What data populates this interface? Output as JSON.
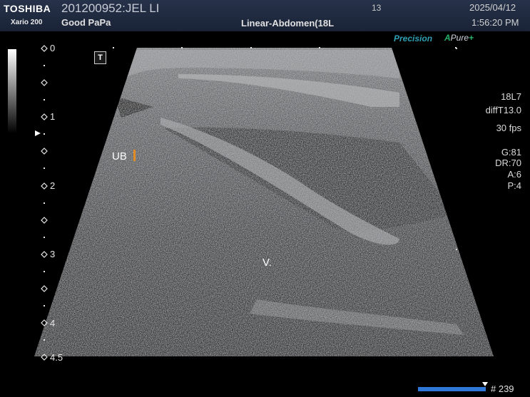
{
  "header": {
    "brand": "TOSHIBA",
    "model": "Xario 200",
    "patient_id": "201200952:JEL LI",
    "hospital": "Good PaPa",
    "frame_number": "13",
    "preset": "Linear-Abdomen(18L",
    "date": "2025/04/12",
    "time": "1:56:20 PM"
  },
  "imaging_modes": {
    "precision": "Precision",
    "apure_a": "A",
    "apure_rest": "Pure",
    "apure_plus": "+"
  },
  "orientation_marker": "T",
  "depth_scale": [
    "0",
    "1",
    "2",
    "3",
    "4",
    "4.5"
  ],
  "parameters": {
    "probe": "18L7",
    "diff": "diffT13.0",
    "fps": "30 fps",
    "gain": "G:81",
    "dynamic_range": "DR:70",
    "a": "A:6",
    "p": "P:4"
  },
  "annotations": {
    "ub": "UB",
    "v": "V."
  },
  "cine": {
    "frame_count": "# 239"
  }
}
